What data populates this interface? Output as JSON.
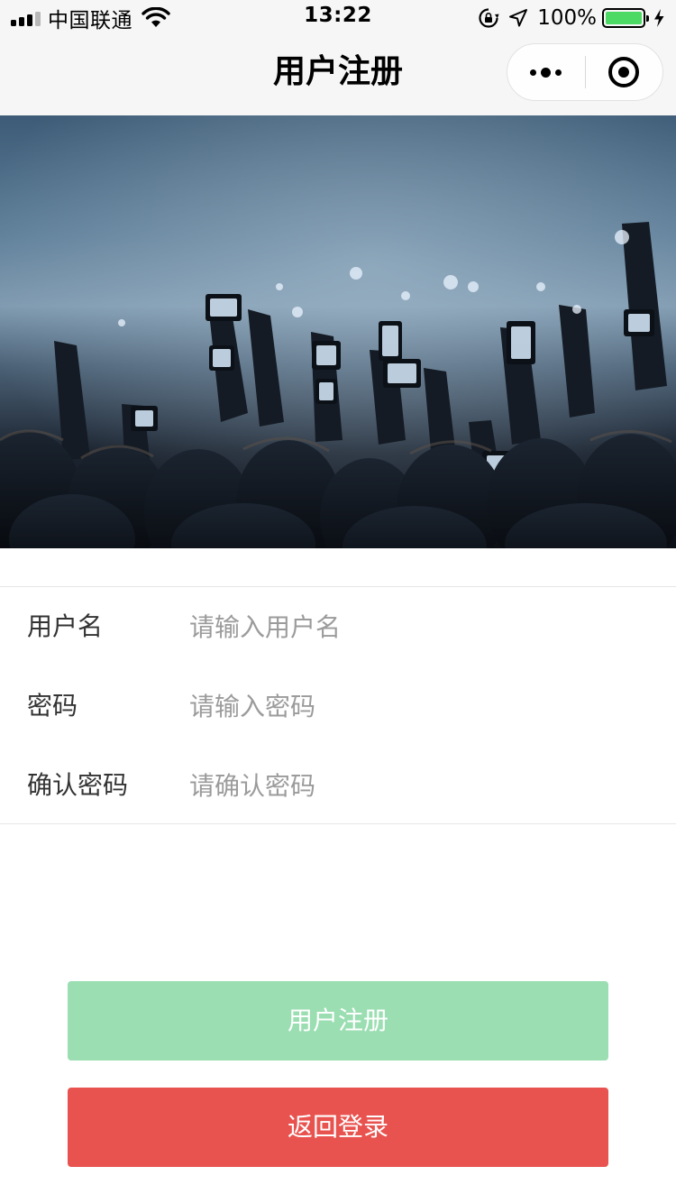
{
  "status_bar": {
    "carrier": "中国联通",
    "time": "13:22",
    "battery_percent": "100%",
    "battery_level": 1.0,
    "signal_bars": 5,
    "signal_bars_filled": 3
  },
  "nav": {
    "title": "用户注册"
  },
  "banner": {
    "image_description": "concert-crowd-phones",
    "icon": "concert-photo"
  },
  "form": {
    "fields": [
      {
        "label": "用户名",
        "placeholder": "请输入用户名",
        "value": ""
      },
      {
        "label": "密码",
        "placeholder": "请输入密码",
        "value": ""
      },
      {
        "label": "确认密码",
        "placeholder": "请确认密码",
        "value": ""
      }
    ]
  },
  "buttons": {
    "register_label": "用户注册",
    "back_label": "返回登录"
  },
  "colors": {
    "register_button": "#9adeb2",
    "back_button": "#e8534f",
    "battery_fill": "#4cd964",
    "nav_background": "#f6f6f6"
  }
}
